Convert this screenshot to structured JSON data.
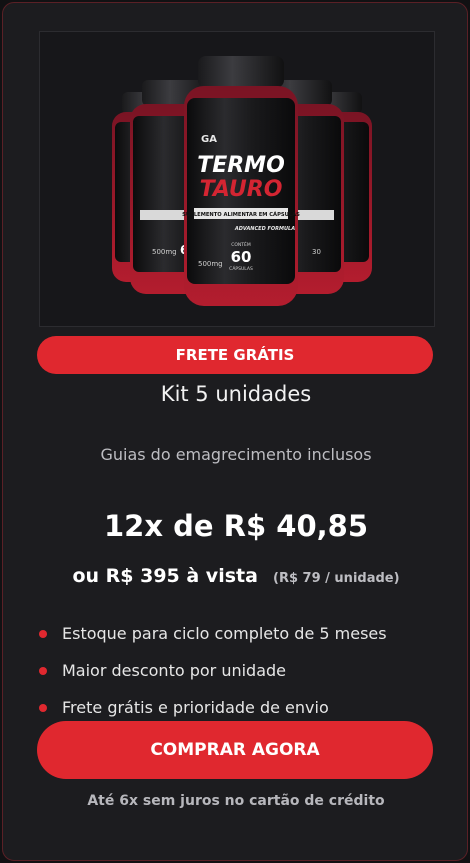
{
  "product": {
    "image_alt": "Termo Tauro kit 5 unidades",
    "brand_mark": "GA",
    "bottle_title_1": "TERMO",
    "bottle_title_2": "TAURO",
    "bottle_subtitle": "SUPLEMENTO ALIMENTAR EM CÁPSULAS",
    "bottle_formula": "ADVANCED FORMULA",
    "bottle_weight": "500mg",
    "bottle_count_label": "CONTÉM",
    "bottle_count": "60",
    "bottle_count_unit": "CÁPSULAS"
  },
  "offer": {
    "badge": "FRETE GRÁTIS",
    "title": "Kit 5 unidades",
    "guides": "Guias do emagrecimento inclusos",
    "installments": "12x de R$ 40,85",
    "cash_price": "ou R$ 395 à vista",
    "unit_price": "(R$ 79 / unidade)",
    "bullets": [
      "Estoque para ciclo completo de 5 meses",
      "Maior desconto por unidade",
      "Frete grátis e prioridade de envio"
    ],
    "cta": "COMPRAR AGORA",
    "footnote": "Até 6x sem juros no cartão de crédito"
  },
  "colors": {
    "accent": "#e0282f",
    "background": "#1c1c1f",
    "border": "#5a2026"
  }
}
